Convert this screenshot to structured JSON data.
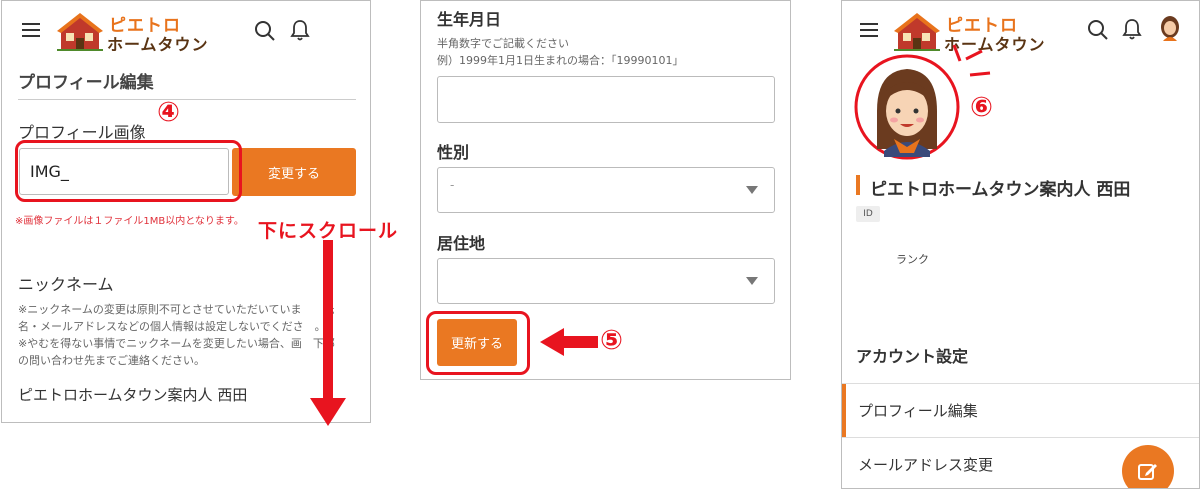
{
  "colors": {
    "accent": "#ea7822",
    "annotation_red": "#e8141f",
    "brand_brown": "#5a3413"
  },
  "brand": {
    "line1": "ピエトロ",
    "line2": "ホームタウン"
  },
  "icons": {
    "menu": "hamburger-icon",
    "search": "search-icon",
    "bell": "bell-icon",
    "edit": "edit-icon",
    "dropdown": "chevron-down-icon"
  },
  "panel1": {
    "page_title": "プロフィール編集",
    "image_label": "プロフィール画像",
    "image_input_value": "IMG_",
    "change_button": "変更する",
    "image_note": "※画像ファイルは１ファイル1MB以内となります。",
    "nickname_label": "ニックネーム",
    "nickname_notes": [
      "※ニックネームの変更は原則不可とさせていただいていま　　氏",
      "名・メールアドレスなどの個人情報は設定しないでくださ　。",
      "※やむを得ない事情でニックネームを変更したい場合、画　下部",
      "の問い合わせ先までご連絡ください。"
    ],
    "nickname_value": "ピエトロホームタウン案内人 西田"
  },
  "panel2": {
    "birthdate_label": "生年月日",
    "birthdate_hint1": "半角数字でご記載ください",
    "birthdate_hint2": "例）1999年1月1日生まれの場合：「19990101」",
    "birthdate_value": "",
    "gender_label": "性別",
    "gender_value": "-",
    "residence_label": "居住地",
    "residence_value": "",
    "update_button": "更新する"
  },
  "panel3": {
    "user_name": "ピエトロホームタウン案内人 西田",
    "id_badge": "ID",
    "rank_label": "ランク",
    "account_settings": "アカウント設定",
    "menu": [
      "プロフィール編集",
      "メールアドレス変更"
    ]
  },
  "annotations": {
    "step4": "④",
    "step5": "⑤",
    "step6": "⑥",
    "scroll_instruction": "下にスクロール"
  }
}
